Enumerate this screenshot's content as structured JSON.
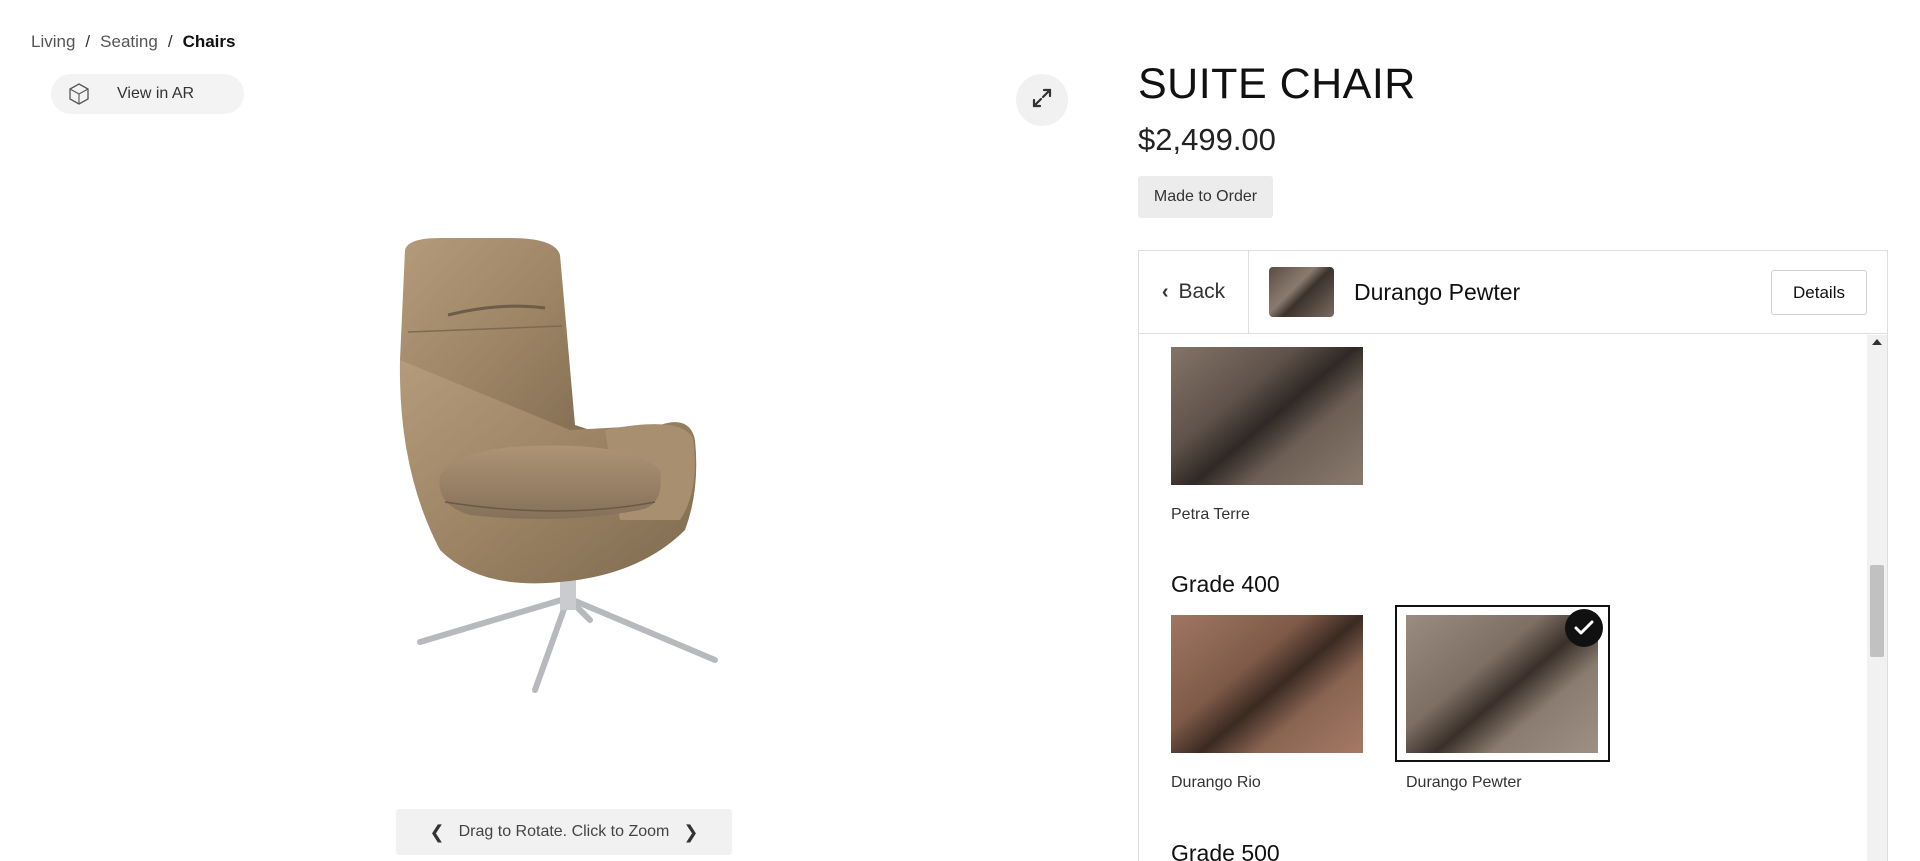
{
  "breadcrumb": {
    "items": [
      "Living",
      "Seating"
    ],
    "current": "Chairs",
    "separator": "/"
  },
  "ar": {
    "label": "View in AR",
    "icon": "ar-cube-icon"
  },
  "viewer": {
    "hint": "Drag to Rotate. Click to Zoom",
    "prev_icon": "chevron-left-icon",
    "next_icon": "chevron-right-icon",
    "expand_icon": "expand-icon"
  },
  "product": {
    "title": "SUITE CHAIR",
    "price": "$2,499.00",
    "badge": "Made to Order"
  },
  "selector": {
    "back_label": "Back",
    "selected_name": "Durango Pewter",
    "details_label": "Details",
    "swatches_top": [
      {
        "name": "Petra Terre",
        "color": "#6f6158"
      }
    ],
    "grades": [
      {
        "title": "Grade 400",
        "swatches": [
          {
            "name": "Durango Rio",
            "color": "#8b6553",
            "selected": false
          },
          {
            "name": "Durango Pewter",
            "color": "#8b7e74",
            "selected": true
          }
        ]
      },
      {
        "title": "Grade 500",
        "swatches": []
      }
    ]
  },
  "colors": {
    "leather": "#a08868",
    "selected_border": "#111111"
  }
}
